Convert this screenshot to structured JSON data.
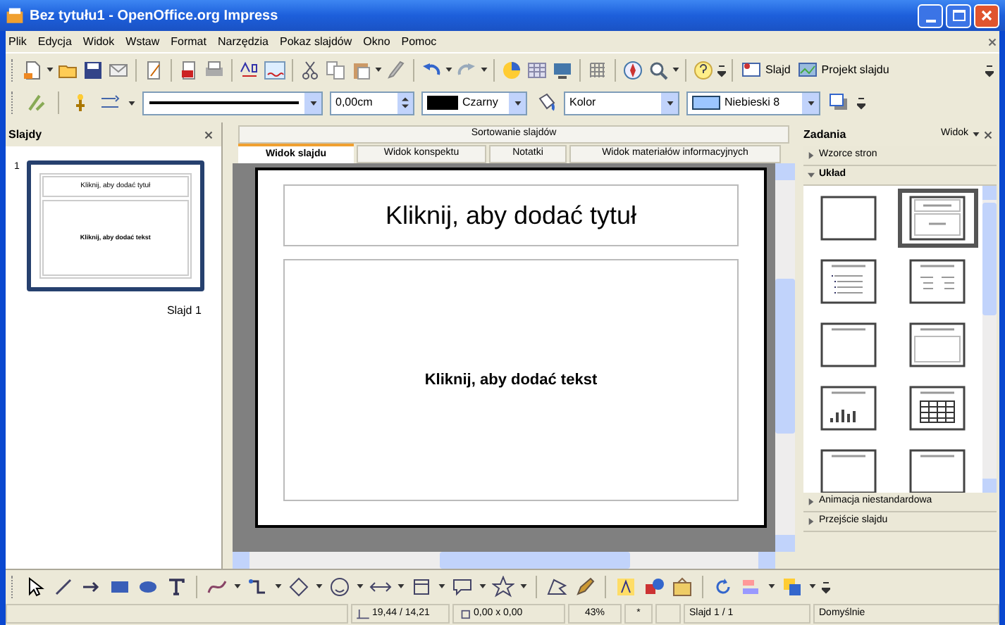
{
  "window": {
    "title": "Bez tytułu1 - OpenOffice.org Impress"
  },
  "menu": [
    "Plik",
    "Edycja",
    "Widok",
    "Wstaw",
    "Format",
    "Narzędzia",
    "Pokaz slajdów",
    "Okno",
    "Pomoc"
  ],
  "toolbar": {
    "slide_button": "Slajd",
    "design_button": "Projekt slajdu"
  },
  "line_toolbar": {
    "line_width": "0,00cm",
    "line_color": "Czarny",
    "area_style": "Kolor",
    "area_fill": "Niebieski 8"
  },
  "slides_pane": {
    "title": "Slajdy",
    "slides": [
      {
        "number": "1",
        "thumb_title": "Kliknij, aby dodać tytuł",
        "thumb_text": "Kliknij, aby dodać tekst",
        "label": "Slajd 1",
        "selected": true
      }
    ]
  },
  "view_tabs": {
    "top": "Sortowanie slajdów",
    "tabs": [
      {
        "label": "Widok slajdu",
        "selected": true
      },
      {
        "label": "Widok konspektu",
        "selected": false
      },
      {
        "label": "Notatki",
        "selected": false
      },
      {
        "label": "Widok materiałów informacyjnych",
        "selected": false
      }
    ]
  },
  "slide": {
    "title_placeholder": "Kliknij, aby dodać tytuł",
    "text_placeholder": "Kliknij, aby dodać tekst"
  },
  "tasks_pane": {
    "title": "Zadania",
    "view_menu": "Widok",
    "sections": [
      {
        "label": "Wzorce stron",
        "expanded": false
      },
      {
        "label": "Układ",
        "expanded": true
      },
      {
        "label": "Animacja niestandardowa",
        "expanded": false
      },
      {
        "label": "Przejście slajdu",
        "expanded": false
      }
    ],
    "layouts": [
      {
        "kind": "blank",
        "selected": false
      },
      {
        "kind": "title-content",
        "selected": true
      },
      {
        "kind": "title-list",
        "selected": false
      },
      {
        "kind": "title-two-lists",
        "selected": false
      },
      {
        "kind": "title-only",
        "selected": false
      },
      {
        "kind": "title-frame",
        "selected": false
      },
      {
        "kind": "title-chart",
        "selected": false
      },
      {
        "kind": "title-table",
        "selected": false
      },
      {
        "kind": "title-only",
        "selected": false
      },
      {
        "kind": "title-only",
        "selected": false
      }
    ]
  },
  "status_bar": {
    "position": "19,44 / 14,21",
    "size": "0,00 x 0,00",
    "zoom": "43%",
    "modified": "*",
    "slide": "Slajd 1 / 1",
    "layout": "Domyślnie"
  }
}
